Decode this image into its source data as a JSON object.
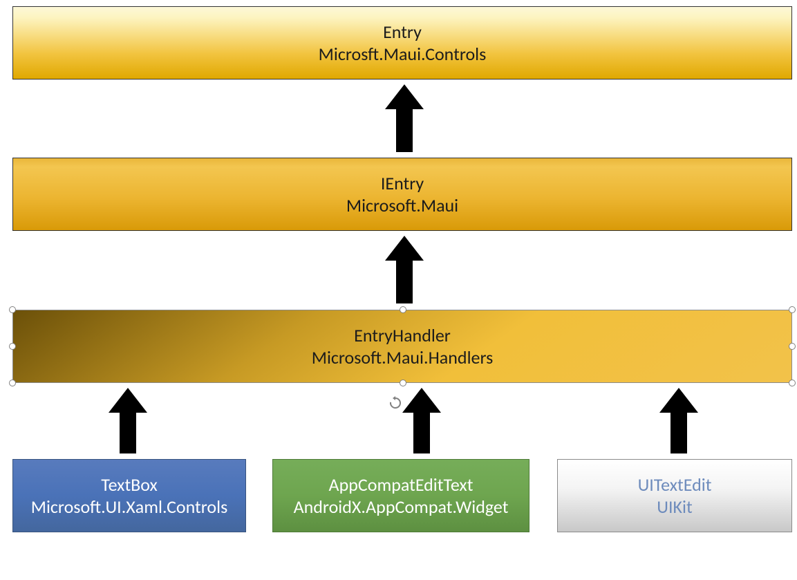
{
  "boxes": {
    "entry": {
      "title": "Entry",
      "subtitle": "Microsft.Maui.Controls"
    },
    "ientry": {
      "title": "IEntry",
      "subtitle": "Microsoft.Maui"
    },
    "handler": {
      "title": "EntryHandler",
      "subtitle": "Microsoft.Maui.Handlers"
    },
    "textbox": {
      "title": "TextBox",
      "subtitle": "Microsoft.UI.Xaml.Controls"
    },
    "appcompat": {
      "title": "AppCompatEditText",
      "subtitle": "AndroidX.AppCompat.Widget"
    },
    "uitext": {
      "title": "UITextEdit",
      "subtitle": "UIKit"
    }
  }
}
